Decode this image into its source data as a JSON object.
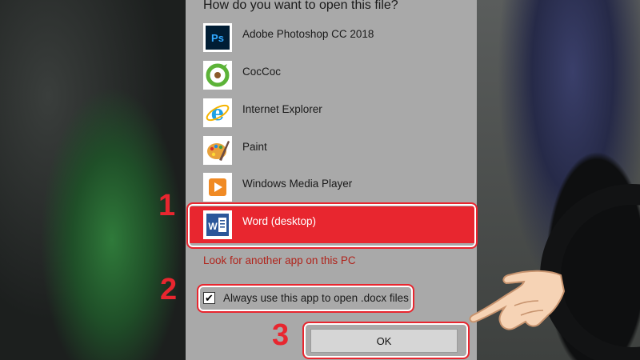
{
  "dialog": {
    "title": "How do you want to open this file?",
    "apps": [
      {
        "label": "Adobe Photoshop CC 2018",
        "icon": "photoshop-icon",
        "color": "#001d34",
        "accent": "#31a8ff"
      },
      {
        "label": "CocCoc",
        "icon": "coccoc-icon",
        "color": "#ffffff",
        "accent": "#4caf50"
      },
      {
        "label": "Internet Explorer",
        "icon": "internet-explorer-icon",
        "color": "#ffffff",
        "accent": "#1ea1e6"
      },
      {
        "label": "Paint",
        "icon": "paint-icon",
        "color": "#ffffff",
        "accent": "#e8a13a"
      },
      {
        "label": "Windows Media Player",
        "icon": "media-player-icon",
        "color": "#ffffff",
        "accent": "#f08a24"
      },
      {
        "label": "Word (desktop)",
        "icon": "word-icon",
        "color": "#2b579a",
        "accent": "#ffffff",
        "selected": true
      }
    ],
    "look_link": "Look for another app on this PC",
    "always_checkbox": {
      "label": "Always use this app to open .docx files",
      "checked": true,
      "check_glyph": "✔"
    },
    "ok_label": "OK"
  },
  "annotations": {
    "steps": [
      "1",
      "2",
      "3"
    ],
    "highlight_color": "#e8262f"
  }
}
